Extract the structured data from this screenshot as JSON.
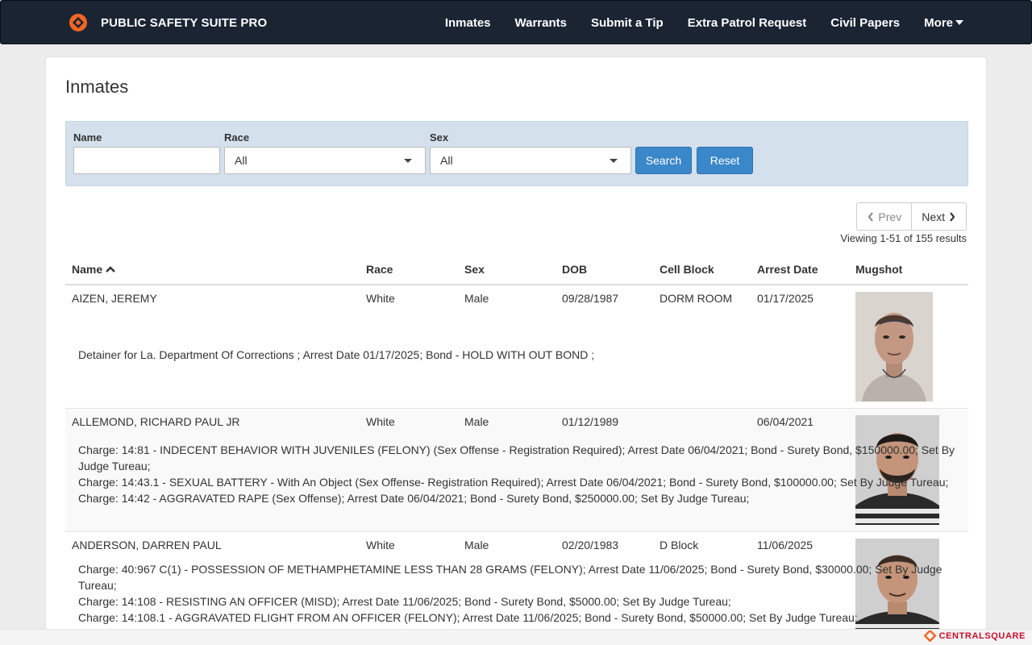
{
  "navbar": {
    "brand": "PUBLIC SAFETY SUITE PRO",
    "links": [
      "Inmates",
      "Warrants",
      "Submit a Tip",
      "Extra Patrol Request",
      "Civil Papers",
      "More"
    ]
  },
  "page": {
    "title": "Inmates"
  },
  "filters": {
    "name_label": "Name",
    "name_value": "",
    "race_label": "Race",
    "race_value": "All",
    "sex_label": "Sex",
    "sex_value": "All",
    "search_label": "Search",
    "reset_label": "Reset"
  },
  "pager": {
    "prev": "Prev",
    "next": "Next",
    "results": "Viewing 1-51 of 155 results"
  },
  "table": {
    "headers": [
      "Name",
      "Race",
      "Sex",
      "DOB",
      "Cell Block",
      "Arrest Date",
      "Mugshot"
    ],
    "rows": [
      {
        "name": "AIZEN, JEREMY",
        "race": "White",
        "sex": "Male",
        "dob": "09/28/1987",
        "cell": "DORM ROOM",
        "arrest": "01/17/2025",
        "charges": [
          "Detainer for La. Department Of Corrections ; Arrest Date 01/17/2025; Bond - HOLD WITH OUT BOND ;"
        ]
      },
      {
        "name": "ALLEMOND, RICHARD PAUL JR",
        "race": "White",
        "sex": "Male",
        "dob": "01/12/1989",
        "cell": "",
        "arrest": "06/04/2021",
        "charges": [
          "Charge: 14:81 - INDECENT BEHAVIOR WITH JUVENILES (FELONY) (Sex Offense - Registration Required); Arrest Date 06/04/2021; Bond - Surety Bond, $150000.00; Set By Judge Tureau;",
          "Charge: 14:43.1 - SEXUAL BATTERY - With An Object (Sex Offense- Registration Required); Arrest Date 06/04/2021; Bond - Surety Bond, $100000.00; Set By Judge Tureau;",
          "Charge: 14:42 - AGGRAVATED RAPE (Sex Offense); Arrest Date 06/04/2021; Bond - Surety Bond, $250000.00; Set By Judge Tureau;"
        ]
      },
      {
        "name": "ANDERSON, DARREN PAUL",
        "race": "White",
        "sex": "Male",
        "dob": "02/20/1983",
        "cell": "D Block",
        "arrest": "11/06/2025",
        "charges": [
          "Charge: 40:967 C(1) - POSSESSION OF METHAMPHETAMINE LESS THAN 28 GRAMS (FELONY); Arrest Date 11/06/2025; Bond - Surety Bond, $30000.00; Set By Judge Tureau;",
          "Charge: 14:108 - RESISTING AN OFFICER (MISD); Arrest Date 11/06/2025; Bond - Surety Bond, $5000.00; Set By Judge Tureau;",
          "Charge: 14:108.1 - AGGRAVATED FLIGHT FROM AN OFFICER (FELONY); Arrest Date 11/06/2025; Bond - Surety Bond, $50000.00; Set By Judge Tureau;"
        ]
      }
    ]
  },
  "footer": {
    "logo_text": "CENTRALSQUARE"
  }
}
